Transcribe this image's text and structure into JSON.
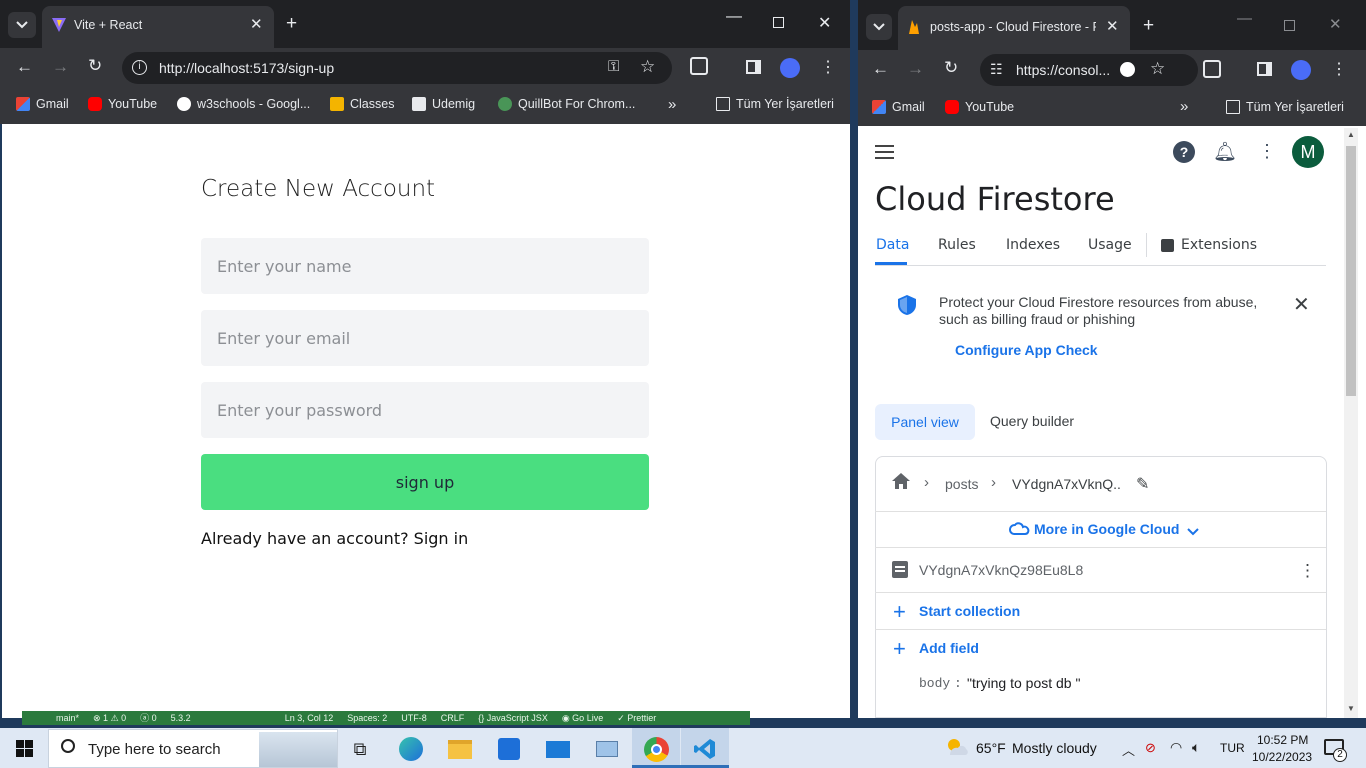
{
  "left_window": {
    "tab_title": "Vite + React",
    "url": "http://localhost:5173/sign-up",
    "bookmarks": [
      "Gmail",
      "YouTube",
      "w3schools - Googl...",
      "Classes",
      "Udemig",
      "QuillBot For Chrom..."
    ],
    "bookmarks_folder": "Tüm Yer İşaretleri",
    "page": {
      "title": "Create New Account",
      "name_placeholder": "Enter your name",
      "email_placeholder": "Enter your email",
      "password_placeholder": "Enter your password",
      "signup_label": "sign up",
      "signin_text": "Already have an account? Sign in"
    }
  },
  "vscode_status": {
    "items": [
      "main*",
      "⊗ 1 ⚠ 0",
      "ⓐ 0",
      "5.3.2",
      "Ln 3, Col 12",
      "Spaces: 2",
      "UTF-8",
      "CRLF",
      "{} JavaScript JSX",
      "◉ Go Live",
      "✓ Prettier"
    ]
  },
  "right_window": {
    "tab_title": "posts-app - Cloud Firestore - F",
    "url": "https://consol...",
    "bookmarks": [
      "Gmail",
      "YouTube"
    ],
    "bookmarks_folder": "Tüm Yer İşaretleri",
    "avatar_letter": "M",
    "page_title": "Cloud Firestore",
    "tabs": [
      "Data",
      "Rules",
      "Indexes",
      "Usage",
      "Extensions"
    ],
    "banner_text": "Protect your Cloud Firestore resources from abuse, such as billing fraud or phishing",
    "banner_link": "Configure App Check",
    "view_toggle": [
      "Panel view",
      "Query builder"
    ],
    "breadcrumb": [
      "posts",
      "VYdgnA7xVknQ.."
    ],
    "more_cloud": "More in Google Cloud",
    "document_id": "VYdgnA7xVknQz98Eu8L8",
    "start_collection": "Start collection",
    "add_field": "Add field",
    "field_key": "body",
    "field_sep": ":",
    "field_value": "\"trying to post db \""
  },
  "taskbar": {
    "search_placeholder": "Type here to search",
    "weather_temp": "65°F",
    "weather_desc": "Mostly cloudy",
    "language": "TUR",
    "time": "10:52 PM",
    "date": "10/22/2023",
    "notification_count": "2"
  },
  "colors": {
    "chrome_dark": "#202124",
    "chrome_mid": "#35363a",
    "signup_green": "#4ade80",
    "firebase_blue": "#1a73e8",
    "avatar_green": "#0b5c3d"
  }
}
